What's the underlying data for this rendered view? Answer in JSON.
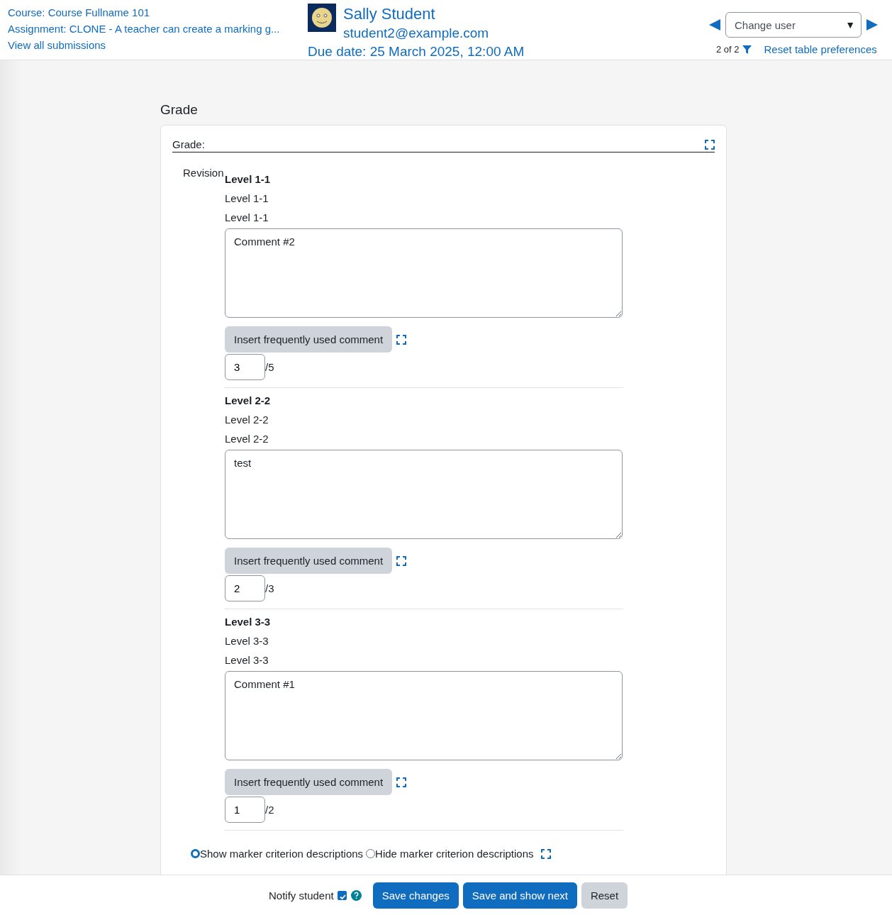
{
  "header": {
    "links": [
      "Course: Course Fullname 101",
      "Assignment: CLONE - A teacher can create a marking g...",
      "View all submissions"
    ],
    "user": {
      "name": "Sally Student",
      "email": "student2@example.com",
      "due": "Due date: 25 March 2025, 12:00 AM"
    },
    "change_user": {
      "placeholder": "Change user",
      "caret": "▼"
    },
    "position": "2 of 2",
    "reset_link": "Reset table preferences"
  },
  "section_title": "Grade",
  "grade_panel": {
    "legend": "Grade:",
    "row_label": "Revision",
    "criteria": [
      {
        "title": "Level 1-1",
        "description": "Level 1-1",
        "marker_description": "Level 1-1",
        "comment": "Comment #2",
        "button": "Insert frequently used comment",
        "score": "3",
        "max": "/5"
      },
      {
        "title": "Level 2-2",
        "description": "Level 2-2",
        "marker_description": "Level 2-2",
        "comment": "test",
        "button": "Insert frequently used comment",
        "score": "2",
        "max": "/3"
      },
      {
        "title": "Level 3-3",
        "description": "Level 3-3",
        "marker_description": "Level 3-3",
        "comment": "Comment #1",
        "button": "Insert frequently used comment",
        "score": "1",
        "max": "/2"
      }
    ],
    "options": [
      {
        "label": "Show marker criterion descriptions",
        "selected": true
      },
      {
        "label": "Hide marker criterion descriptions",
        "selected": false
      }
    ]
  },
  "footer": {
    "notify": {
      "label": "Notify student",
      "checked": true
    },
    "buttons": [
      {
        "label": "Save changes",
        "kind": "primary"
      },
      {
        "label": "Save and show next",
        "kind": "primary"
      },
      {
        "label": "Reset",
        "kind": "secondary"
      }
    ]
  }
}
